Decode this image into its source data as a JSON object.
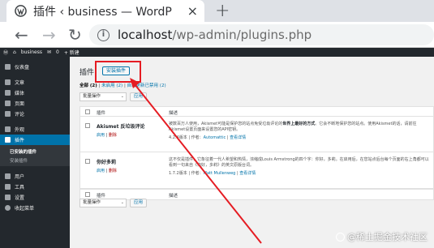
{
  "browser": {
    "tab_title": "插件 ‹ business — WordP",
    "url_host": "localhost",
    "url_path": "/wp-admin/plugins.php"
  },
  "adminbar": {
    "site": "business",
    "comments": "0",
    "new": "+ 新建"
  },
  "sidebar": {
    "items": [
      {
        "label": "仪表盘"
      },
      {
        "label": "文章"
      },
      {
        "label": "媒体"
      },
      {
        "label": "页面"
      },
      {
        "label": "评论"
      },
      {
        "label": "外观"
      },
      {
        "label": "插件"
      }
    ],
    "plugins_sub": [
      "已安装的插件",
      "安装插件"
    ],
    "items_bottom": [
      {
        "label": "用户"
      },
      {
        "label": "工具"
      },
      {
        "label": "设置"
      },
      {
        "label": "收起菜单"
      }
    ]
  },
  "main": {
    "title": "插件",
    "add_button": "安装插件",
    "filters": {
      "all": "全部 (2)",
      "inactive": "未启用 (2)",
      "autoupdate": "自动更新已禁用 (2)"
    },
    "bulk_select": "批量操作",
    "apply": "应用",
    "col_plugin": "插件",
    "col_desc": "描述",
    "plugins": [
      {
        "name": "Akismet 反垃圾评论",
        "activate": "启用",
        "delete": "删除",
        "desc_pre": "被数百万人使用，Akismet可能是保护您的站点免受垃圾评论的",
        "desc_bold": "世界上最好的方式",
        "desc_post": "。它会不断地保护您的站点。使用Akismet的话，请前往Akismet设置页面来设置您的API密钥。",
        "version": "4.2.4版本",
        "author_label": "作者：",
        "author": "Automattic",
        "details": "查看详情"
      },
      {
        "name": "你好多莉",
        "activate": "启用",
        "delete": "删除",
        "desc_pre": "这不仅是插件，它象征着一代人希望和热情，浓缩成Louis Armstrong的四个字：你好，多莉。在启用后，在您站点后台每个页面的右上角都可以看到一句来自《你好，多莉》的英文原版台词。",
        "desc_bold": "",
        "desc_post": "",
        "version": "1.7.2版本",
        "author_label": "作者：",
        "author": "Matt Mullenweg",
        "details": "查看详情"
      }
    ]
  },
  "watermark": "@稀土掘金技术社区",
  "colors": {
    "annotation": "#e51c23",
    "wp_blue": "#0073aa",
    "wp_dark": "#23282d"
  }
}
